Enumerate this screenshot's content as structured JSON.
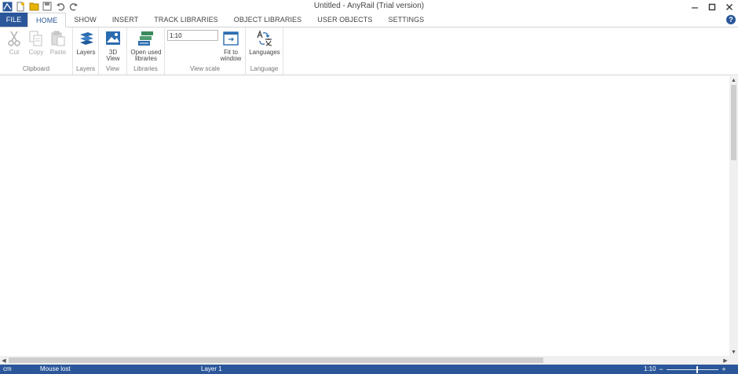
{
  "titlebar": {
    "title": "Untitled - AnyRail (Trial version)",
    "quick_access": [
      "app-icon",
      "new-file-icon",
      "open-folder-icon",
      "save-icon",
      "undo-icon",
      "redo-icon"
    ],
    "window_controls": {
      "minimize": "🗕",
      "maximize": "🗖",
      "close": "✕"
    }
  },
  "tabs": [
    {
      "label": "FILE",
      "active": false
    },
    {
      "label": "HOME",
      "active": true
    },
    {
      "label": "SHOW",
      "active": false
    },
    {
      "label": "INSERT",
      "active": false
    },
    {
      "label": "TRACK LIBRARIES",
      "active": false
    },
    {
      "label": "OBJECT LIBRARIES",
      "active": false
    },
    {
      "label": "USER OBJECTS",
      "active": false
    },
    {
      "label": "SETTINGS",
      "active": false
    }
  ],
  "help_label": "?",
  "ribbon": {
    "clipboard": {
      "label": "Clipboard",
      "cut": "Cut",
      "copy": "Copy",
      "paste": "Paste"
    },
    "layers": {
      "label": "Layers",
      "button": "Layers"
    },
    "view": {
      "label": "View",
      "button_line1": "3D",
      "button_line2": "View"
    },
    "libraries": {
      "label": "Libraries",
      "button_line1": "Open used",
      "button_line2": "libraries"
    },
    "view_scale": {
      "label": "View scale",
      "scale_value": "1:10",
      "fit_line1": "Fit to",
      "fit_line2": "window"
    },
    "language": {
      "label": "Language",
      "button": "Languages"
    }
  },
  "scrollbars": {
    "up": "▲",
    "down": "▼",
    "left": "◀",
    "right": "▶"
  },
  "status": {
    "unit": "cm",
    "mouse": "Mouse lost",
    "layer": "Layer 1",
    "scale": "1:10",
    "zoom_minus": "−",
    "zoom_plus": "+",
    "zoom_level": 0.6
  },
  "colors": {
    "accent": "#2b579a",
    "icon_blue": "#2b6cb0",
    "icon_green": "#3a8a5c"
  }
}
